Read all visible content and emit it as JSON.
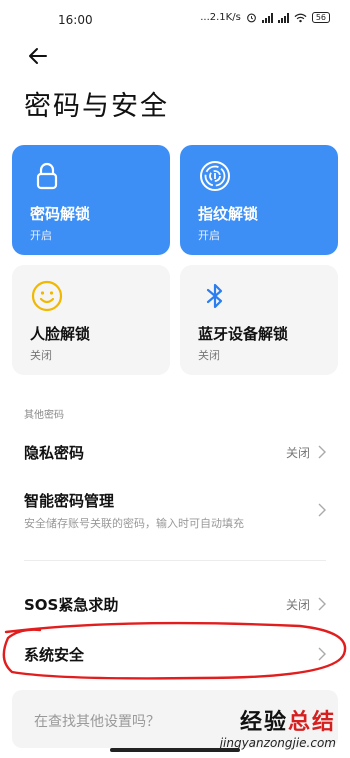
{
  "status_bar": {
    "time": "16:00",
    "network_speed": "...2.1K/s",
    "battery": "56"
  },
  "page": {
    "title": "密码与安全"
  },
  "tiles": [
    {
      "name": "密码解锁",
      "state": "开启",
      "icon": "lock-icon",
      "active": true
    },
    {
      "name": "指纹解锁",
      "state": "开启",
      "icon": "fingerprint-icon",
      "active": true
    },
    {
      "name": "人脸解锁",
      "state": "关闭",
      "icon": "face-icon",
      "active": false
    },
    {
      "name": "蓝牙设备解锁",
      "state": "关闭",
      "icon": "bluetooth-icon",
      "active": false
    }
  ],
  "section": {
    "other_passwords": "其他密码"
  },
  "rows": {
    "privacy_password": {
      "label": "隐私密码",
      "value": "关闭"
    },
    "password_manager": {
      "label": "智能密码管理",
      "subtitle": "安全储存账号关联的密码，输入时可自动填充"
    },
    "sos": {
      "label": "SOS紧急求助",
      "value": "关闭"
    },
    "system_security": {
      "label": "系统安全"
    }
  },
  "search": {
    "placeholder": "在查找其他设置吗？"
  },
  "watermark": {
    "main_prefix": "经验",
    "main_accent": "总结",
    "url": "jingyanzongjie.com"
  },
  "colors": {
    "tile_active": "#3d8ff6",
    "tile_inactive": "#f5f5f5",
    "annotation": "#e11d1d",
    "bluetooth": "#2a7ef0",
    "face": "#f0b800"
  }
}
